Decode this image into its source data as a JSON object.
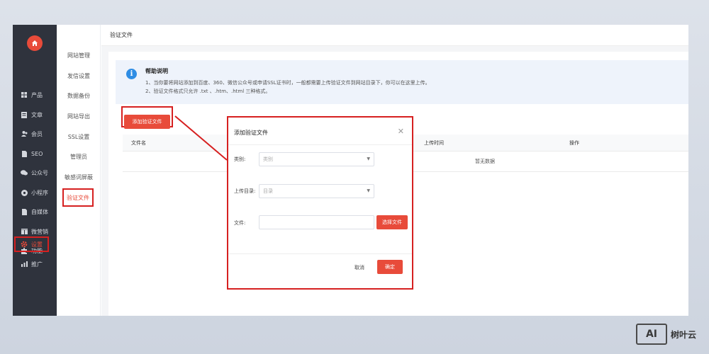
{
  "sidebar": {
    "items": [
      {
        "label": "产品",
        "icon": "grid-icon"
      },
      {
        "label": "文章",
        "icon": "document-icon"
      },
      {
        "label": "会员",
        "icon": "users-icon"
      },
      {
        "label": "SEO",
        "icon": "file-icon"
      },
      {
        "label": "公众号",
        "icon": "wechat-icon"
      },
      {
        "label": "小程序",
        "icon": "mini-program-icon"
      },
      {
        "label": "自媒体",
        "icon": "media-icon"
      },
      {
        "label": "微营销",
        "icon": "marketing-icon"
      },
      {
        "label": "功能",
        "icon": "puzzle-icon"
      },
      {
        "label": "设置",
        "icon": "gear-icon"
      },
      {
        "label": "推广",
        "icon": "chart-icon"
      }
    ]
  },
  "subnav": {
    "items": [
      "网站管理",
      "发信设置",
      "数据备份",
      "网站导出",
      "SSL设置",
      "管理员",
      "敏感词屏蔽",
      "验证文件"
    ]
  },
  "page": {
    "title": "验证文件"
  },
  "help": {
    "title": "帮助说明",
    "line1": "1、当你要将网站添加到百度、360、微信公众号或申请SSL证书时，一般都需要上传验证文件到网站目录下，你可以在这里上传。",
    "line2": "2、验证文件格式只允许 .txt 、.htm、.html 三种格式。"
  },
  "toolbar": {
    "add_label": "添加验证文件"
  },
  "table": {
    "columns": [
      "文件名",
      "上传时间",
      "操作"
    ],
    "empty": "暂无数据"
  },
  "modal": {
    "title": "添加验证文件",
    "category_label": "类别:",
    "category_placeholder": "类别",
    "dir_label": "上传目录:",
    "dir_placeholder": "目录",
    "file_label": "文件:",
    "choose_label": "选择文件",
    "cancel_label": "取消",
    "ok_label": "确定"
  },
  "brand": {
    "logo": "AI",
    "name": "树叶云"
  },
  "colors": {
    "accent": "#e84b3a",
    "highlight": "#d62020",
    "sidebar": "#2f333d",
    "info": "#2f8de4"
  }
}
